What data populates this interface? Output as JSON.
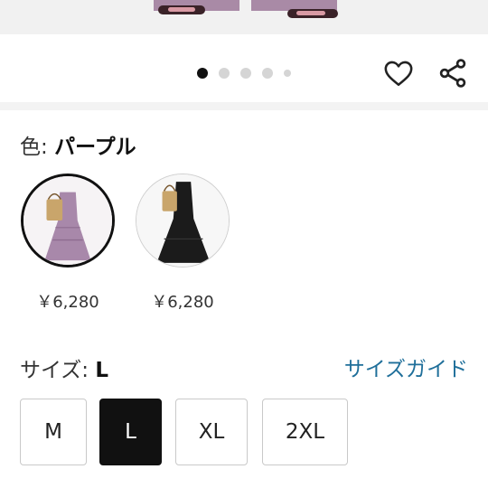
{
  "product": {
    "color_label": "色: ",
    "color_value": "パープル",
    "swatches": [
      {
        "name": "purple",
        "price": "￥6,280",
        "selected": true,
        "color": "#a888aa"
      },
      {
        "name": "black",
        "price": "￥6,280",
        "selected": false,
        "color": "#1b1b1b"
      }
    ],
    "size_label": "サイズ: ",
    "size_value": "L",
    "size_guide": "サイズガイド",
    "sizes": [
      {
        "label": "M",
        "selected": false
      },
      {
        "label": "L",
        "selected": true
      },
      {
        "label": "XL",
        "selected": false
      },
      {
        "label": "2XL",
        "selected": false
      }
    ]
  },
  "carousel": {
    "total_dots": 5,
    "active_index": 0
  },
  "icons": {
    "favorite": "heart-icon",
    "share": "share-icon"
  },
  "colors": {
    "accent_link": "#1f6f9a",
    "selected_size_bg": "#111111"
  }
}
